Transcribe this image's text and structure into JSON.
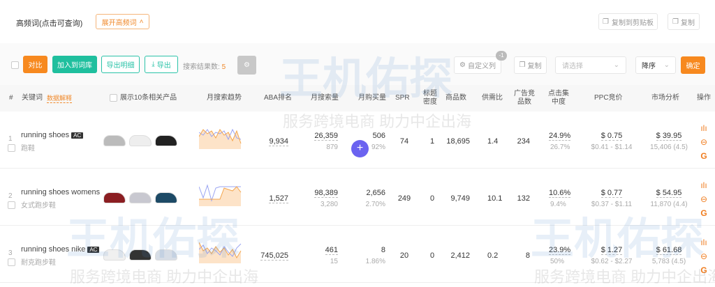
{
  "header": {
    "title": "高频词(点击可查询)",
    "expand_label": "展开高频词",
    "copy_clipboard": "复制到剪贴板",
    "copy": "复制"
  },
  "toolbar": {
    "compare": "对比",
    "add_lib": "加入到词库",
    "export_detail": "导出明细",
    "export": "导出",
    "result_label": "搜索结果数:",
    "result_count": "5",
    "custom_cols": "自定义列",
    "custom_badge": "-1",
    "copy": "复制",
    "select_placeholder": "请选择",
    "sort": "降序",
    "confirm": "确定"
  },
  "columns": {
    "idx": "#",
    "keyword": "关键词",
    "data_explain": "数据解释",
    "show_products": "展示10条相关产品",
    "trend": "月搜索趋势",
    "aba": "ABA排名",
    "search_vol": "月搜索量",
    "purchase": "月购买量",
    "spr": "SPR",
    "title_density": "标题密度",
    "products": "商品数",
    "supply_demand": "供需比",
    "ad_products": "广告竞品数",
    "click_conc": "点击集中度",
    "ppc": "PPC竞价",
    "market": "市场分析",
    "ops": "操作"
  },
  "rows": [
    {
      "idx": "1",
      "keyword": "running shoes",
      "ac": "AC",
      "cn": "跑鞋",
      "aba": "9,934",
      "search": "26,359",
      "search_sub": "879",
      "purchase": "506",
      "purchase_sub": "92%",
      "spr": "74",
      "density": "1",
      "products": "18,695",
      "ratio": "1.4",
      "ads": "234",
      "click": "24.9%",
      "click_sub": "26.7%",
      "ppc": "$ 0.75",
      "ppc_range": "$0.41 - $1.14",
      "market": "$ 39.95",
      "market_sub": "15,406 (4.5)"
    },
    {
      "idx": "2",
      "keyword": "running shoes womens",
      "ac": "",
      "cn": "女式跑步鞋",
      "aba": "1,527",
      "search": "98,389",
      "search_sub": "3,280",
      "purchase": "2,656",
      "purchase_sub": "2.70%",
      "spr": "249",
      "density": "0",
      "products": "9,749",
      "ratio": "10.1",
      "ads": "132",
      "click": "10.6%",
      "click_sub": "9.4%",
      "ppc": "$ 0.77",
      "ppc_range": "$0.37 - $1.11",
      "market": "$ 54.95",
      "market_sub": "11,870 (4.4)"
    },
    {
      "idx": "3",
      "keyword": "running shoes nike",
      "ac": "AC",
      "cn": "耐克跑步鞋",
      "aba": "745,025",
      "search": "461",
      "search_sub": "15",
      "purchase": "8",
      "purchase_sub": "1.86%",
      "spr": "20",
      "density": "0",
      "products": "2,412",
      "ratio": "0.2",
      "ads": "8",
      "click": "23.9%",
      "click_sub": "50%",
      "ppc": "$ 1.27",
      "ppc_range": "$0.62 - $2.27",
      "market": "$ 61.68",
      "market_sub": "5,783 (4.5)"
    }
  ],
  "watermark": {
    "logo": "王机佑探",
    "slogan": "服务跨境电商 助力中企出海"
  },
  "fab": "+"
}
